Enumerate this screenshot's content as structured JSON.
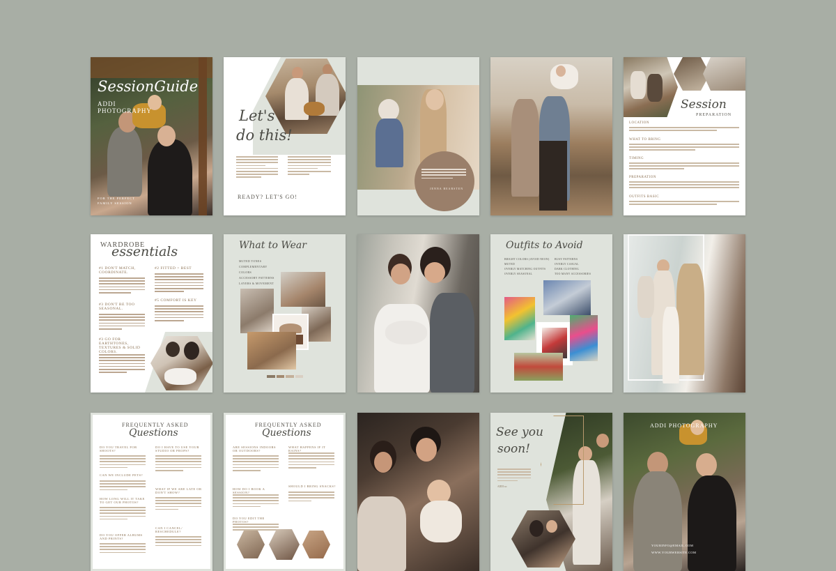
{
  "colors": {
    "background": "#a8aea5",
    "sage": "#dfe3dc",
    "accent": "#8a6f50"
  },
  "row1": {
    "cover": {
      "title": "SessionGuide",
      "brand_line1": "ADDI",
      "brand_line2": "PHOTOGRAPHY",
      "footer_line1": "FOR THE PERFECT",
      "footer_line2": "FAMILY SESSION"
    },
    "lets_do_this": {
      "title_line1": "Let's",
      "title_line2": "do this!",
      "cta": "READY? LET'S GO!"
    },
    "quote": {
      "author": "JENNA BEARSTEN"
    },
    "prep": {
      "title": "Session",
      "subtitle": "PREPARATION",
      "sections": [
        "LOCATION",
        "WHAT TO BRING",
        "TIMING",
        "PREPARATION",
        "OUTFITS BASIC"
      ]
    }
  },
  "row2": {
    "wardrobe": {
      "title_line1": "WARDROBE",
      "title_line2": "essentials",
      "items": [
        "#1 DON'T MATCH, COORDINATE.",
        "#2 FITTED > BEST",
        "#3 DON'T BE TOO SEASONAL.",
        "#5 COMFORT IS KEY",
        "#3 GO FOR EARTHTONES, TEXTURES & SOLID COLORS."
      ]
    },
    "what_to_wear": {
      "title": "What to Wear",
      "items": [
        "MUTED TONES",
        "COMPLEMENTARY",
        "COLORS",
        "ACCESSORY PATTERNS",
        "LAYERS & MOVEMENT"
      ]
    },
    "outfits_avoid": {
      "title": "Outfits to Avoid",
      "col1": [
        "BRIGHT COLORS (AVOID NEON)",
        "MUTED",
        "OVERLY MATCHING OUTFITS",
        "OVERLY SEASONAL"
      ],
      "col2": [
        "BUSY PATTERNS",
        "OVERLY CASUAL",
        "DARK CLOTHING",
        "TOO MANY ACCESSORIES"
      ]
    }
  },
  "row3": {
    "faq1": {
      "title_top": "FREQUENTLY ASKED",
      "title_script": "Questions",
      "questions": [
        "DO YOU TRAVEL FOR SHOOTS?",
        "DO I HAVE TO USE YOUR STUDIO OR PROPS?",
        "CAN WE INCLUDE PETS?",
        "HOW LONG WILL IT TAKE TO GET OUR PHOTOS?",
        "WHAT IF WE ARE LATE OR DON'T SHOW?",
        "DO YOU OFFER ALBUMS AND PRINTS?",
        "CAN I CANCEL/ RESCHEDULE?"
      ]
    },
    "faq2": {
      "title_top": "FREQUENTLY ASKED",
      "title_script": "Questions",
      "questions": [
        "ARE SESSIONS INDOORS OR OUTDOORS?",
        "WHAT HAPPENS IF IT RAINS?",
        "HOW DO I BOOK A SESSION?",
        "SHOULD I BRING SNACKS?",
        "DO YOU EDIT THE PHOTOS?"
      ]
    },
    "see_you": {
      "title_line1": "See you",
      "title_line2": "soon!",
      "signature": "ADDI xo"
    },
    "back_cover": {
      "brand": "ADDI PHOTOGRAPHY",
      "email": "YOURINFO@EMAIL.COM",
      "website": "WWW.YOURWEBSITE.COM"
    }
  }
}
